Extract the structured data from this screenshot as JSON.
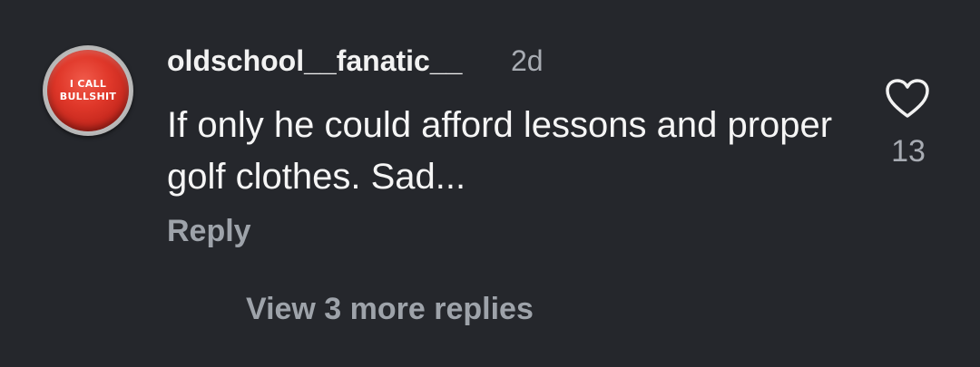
{
  "comment": {
    "avatar": {
      "text_line1": "I CALL",
      "text_line2": "BULLSHIT",
      "color": "#d9332a"
    },
    "username": "oldschool__fanatic__",
    "timestamp": "2d",
    "text": "If only he could afford lessons and proper golf clothes. Sad...",
    "reply_label": "Reply",
    "like_icon": "heart-outline-icon",
    "like_count": "13"
  },
  "thread": {
    "view_more_label": "View 3 more replies"
  },
  "colors": {
    "background": "#25272c",
    "primary_text": "#f2f2f2",
    "secondary_text": "#a8acb3"
  }
}
